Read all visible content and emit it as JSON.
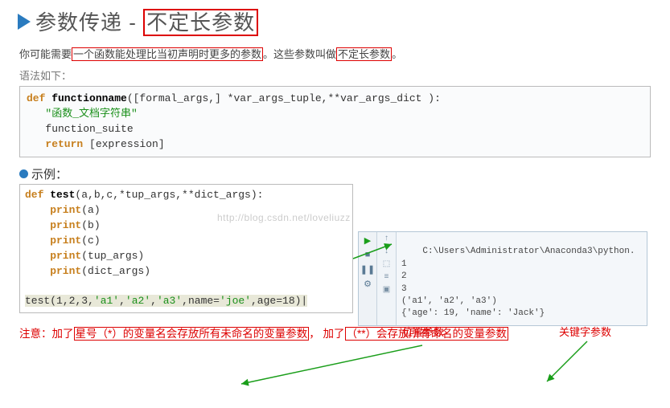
{
  "title": {
    "prefix": "参数传递 - ",
    "boxed": "不定长参数"
  },
  "para": {
    "t1": "你可能需要",
    "u1": "一个函数能处理比当初声明时更多的参数",
    "t2": "。这些参数叫做",
    "u2": "不定长参数",
    "t3": "。"
  },
  "syntax_label": "语法如下：",
  "code1": {
    "l1a": "def",
    "l1b": " functionname",
    "l1c": "([formal_args,] *var_args_tuple,**var_args_dict ):",
    "l2": "   \"函数_文档字符串\"",
    "l3": "   function_suite",
    "l4a": "   return",
    "l4b": " [expression]"
  },
  "watermark": "http://blog.csdn.net/loveliuzz",
  "example_label": "示例：",
  "code2": {
    "l1a": "def",
    "l1b": " test",
    "l1c": "(a,b,c,*tup_args,**dict_args):",
    "l2a": "    print",
    "l2b": "(a)",
    "l3a": "    print",
    "l3b": "(b)",
    "l4a": "    print",
    "l4b": "(c)",
    "l5a": "    print",
    "l5b": "(tup_args)",
    "l6a": "    print",
    "l6b": "(dict_args)",
    "l7": "",
    "l8a": "test(",
    "l8b": "1",
    "l8c": ",",
    "l8d": "2",
    "l8e": ",",
    "l8f": "3",
    "l8g": ",",
    "l8h": "'a1'",
    "l8i": ",",
    "l8j": "'a2'",
    "l8k": ",",
    "l8l": "'a3'",
    "l8m": ",name=",
    "l8n": "'joe'",
    "l8o": ",age=",
    "l8p": "18",
    "l8q": ")|"
  },
  "output": {
    "path": "C:\\Users\\Administrator\\Anaconda3\\python.",
    "l1": "1",
    "l2": "2",
    "l3": "3",
    "l4": "('a1', 'a2', 'a3')",
    "l5": "{'age': 19, 'name': 'Jack'}"
  },
  "pos_label": "位置参数",
  "key_label": "关键字参数",
  "note": {
    "a": "注意：加了",
    "b": "星号（*）的变量名会存放所有未命名的变量参数",
    "c": "，  加了",
    "d": "（**）会存放所有命名的变量参数"
  }
}
